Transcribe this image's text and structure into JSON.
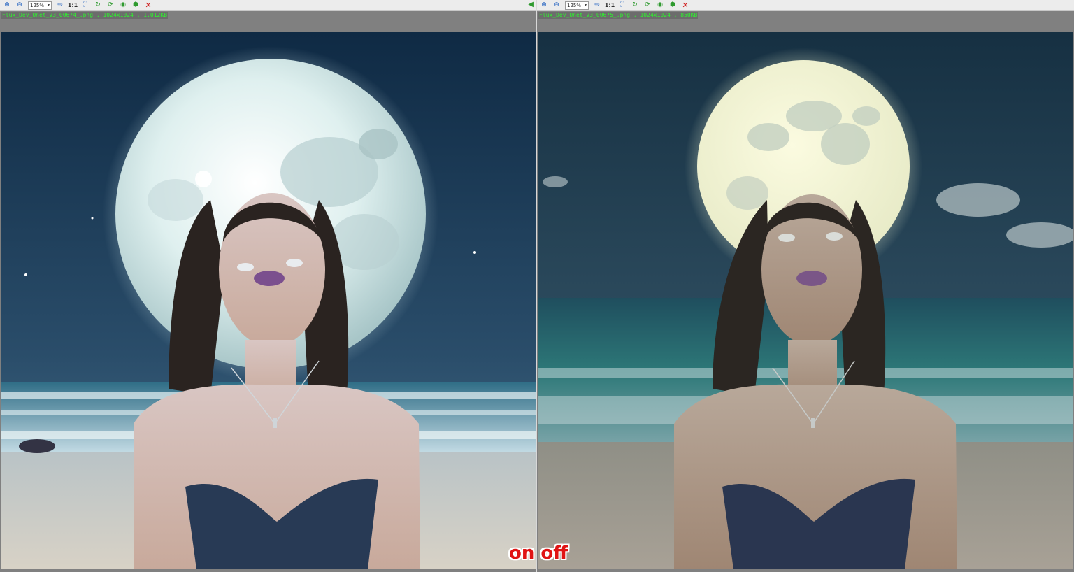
{
  "left_pane": {
    "zoom_value": "125%",
    "actual_size_label": "1:1",
    "file_info": "Flux_Dev_Unet_V3_00674_.png , 1024x1024 , 1,012KB"
  },
  "right_pane": {
    "zoom_value": "125%",
    "actual_size_label": "1:1",
    "file_info": "Flux_Dev_Unet_V3_00675_.png , 1024x1024 , 850KB"
  },
  "overlay": {
    "label": "on off"
  },
  "colors": {
    "file_info_text": "#2ef32e",
    "overlay_text": "#e01414"
  },
  "icons": [
    "zoom-in-icon",
    "zoom-out-icon",
    "next-icon",
    "fit-icon",
    "rotate-icon",
    "refresh-icon",
    "open-icon",
    "save-icon",
    "close-icon",
    "sync-arrow-icon"
  ]
}
